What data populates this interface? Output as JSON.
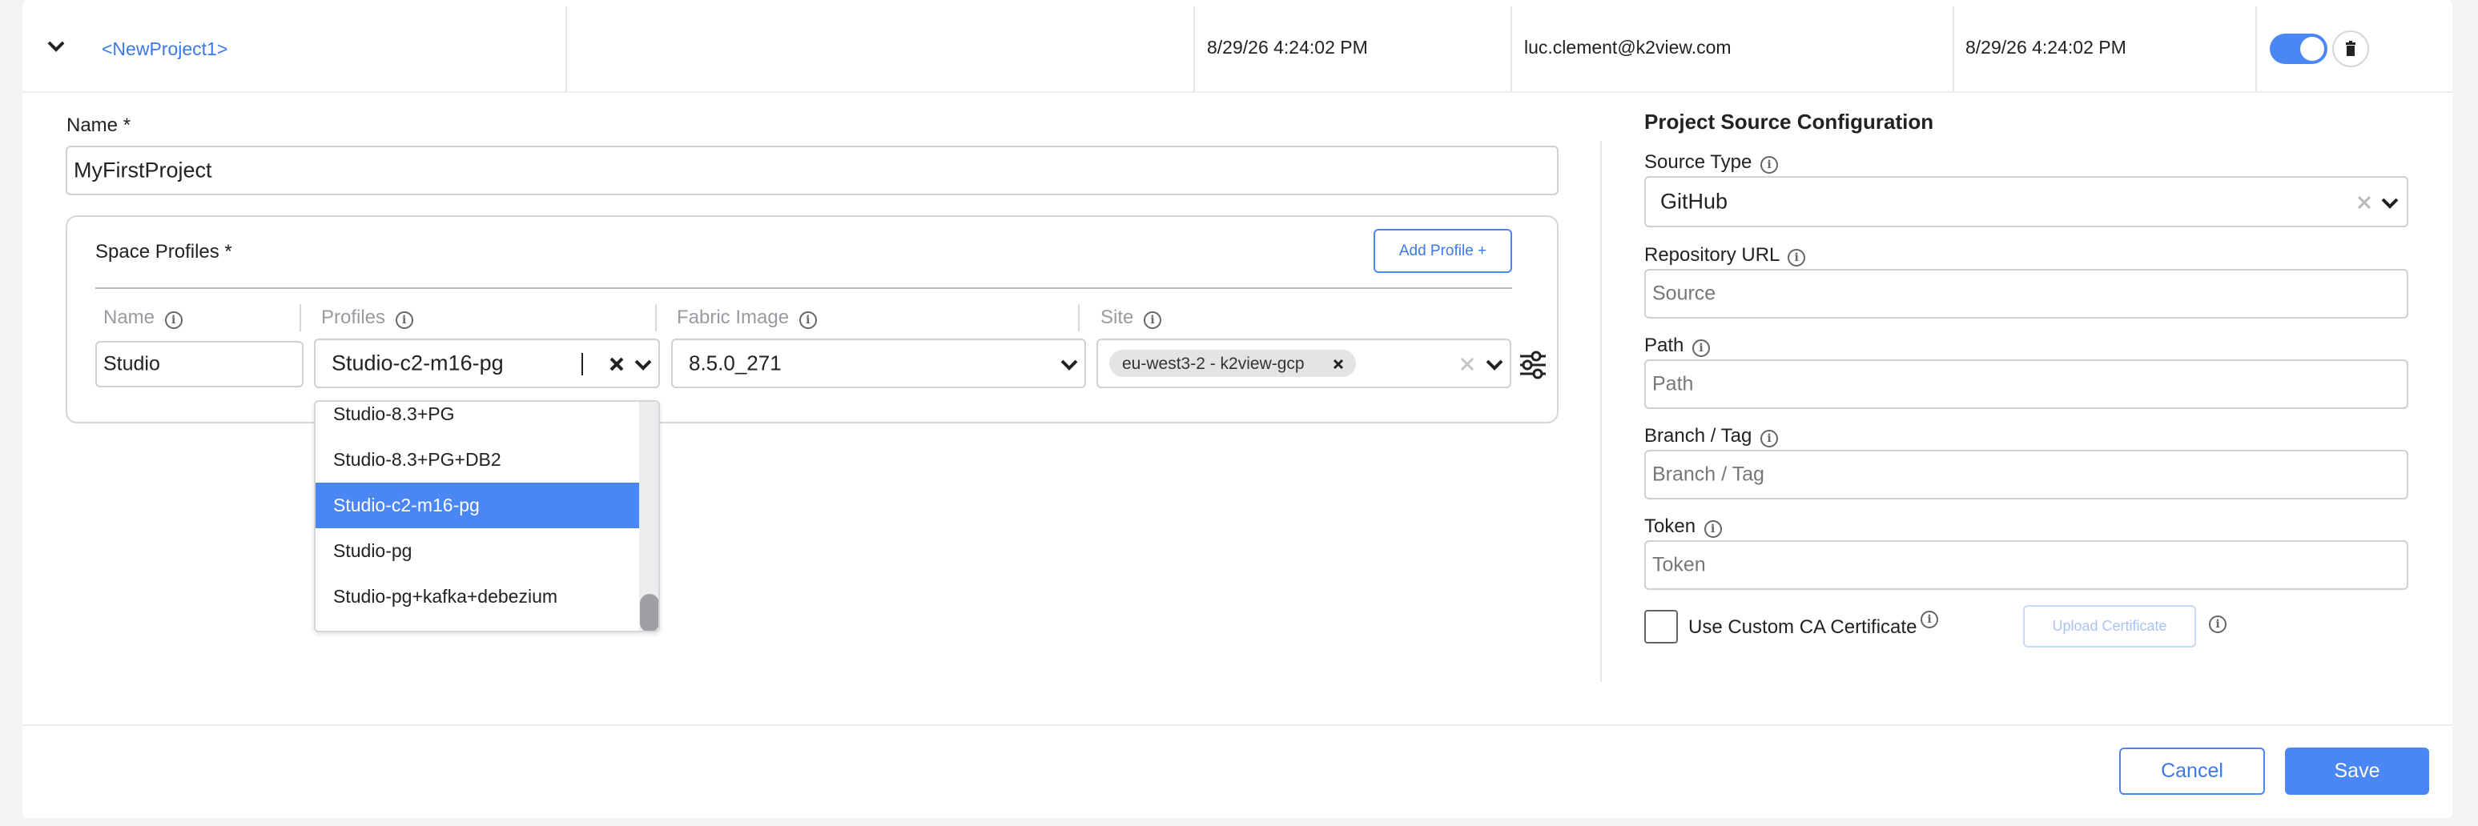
{
  "row": {
    "project_link": "<NewProject1>",
    "created": "8/29/26 4:24:02 PM",
    "owner": "luc.clement@k2view.com",
    "updated": "8/29/26 4:24:02 PM"
  },
  "form": {
    "name_label": "Name *",
    "name_value": "MyFirstProject",
    "space_profiles_title": "Space Profiles *",
    "add_profile_label": "Add Profile +",
    "columns": {
      "name": "Name",
      "profiles": "Profiles",
      "fabric_image": "Fabric Image",
      "site": "Site"
    },
    "profile_row": {
      "name": "Studio",
      "profile": "Studio-c2-m16-pg",
      "fabric_image": "8.5.0_271",
      "site_chip": "eu-west3-2 - k2view-gcp"
    },
    "profile_options": [
      "Studio-8.3+PG",
      "Studio-8.3+PG+DB2",
      "Studio-c2-m16-pg",
      "Studio-pg",
      "Studio-pg+kafka+debezium"
    ],
    "selected_profile_index": 2
  },
  "source": {
    "title": "Project Source Configuration",
    "source_type_label": "Source Type",
    "source_type_value": "GitHub",
    "repo_label": "Repository URL",
    "repo_placeholder": "Source",
    "path_label": "Path",
    "path_placeholder": "Path",
    "branch_label": "Branch / Tag",
    "branch_placeholder": "Branch / Tag",
    "token_label": "Token",
    "token_placeholder": "Token",
    "custom_ca_label": "Use Custom CA Certificate",
    "upload_label": "Upload Certificate"
  },
  "footer": {
    "cancel": "Cancel",
    "save": "Save"
  },
  "colors": {
    "accent": "#4a86f4",
    "link": "#3c78e8",
    "border": "#cfcfd4"
  },
  "icons": [
    "chevron-down-icon",
    "trash-icon",
    "info-icon",
    "close-icon",
    "sliders-icon"
  ]
}
